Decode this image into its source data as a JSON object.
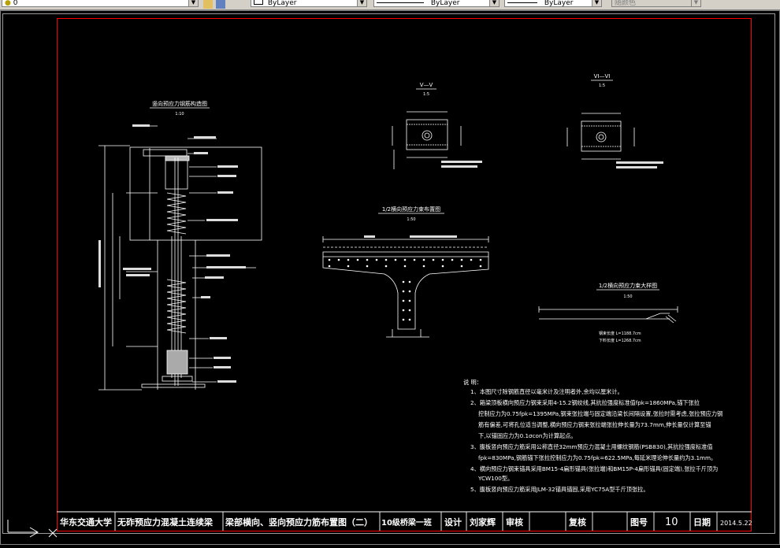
{
  "toolbar": {
    "layer_value": "0",
    "color_value": "ByLayer",
    "linetype_value": "ByLayer",
    "lineweight_value": "ByLayer",
    "plotstyle_value": "随颜色"
  },
  "drawing": {
    "left_title": "竖向预应力钢筋构造图",
    "left_scale": "1:10",
    "sec5_title": "V—V",
    "sec5_scale": "1:5",
    "sec6_title": "VI—VI",
    "sec6_scale": "1:5",
    "layout_title": "1/2横向预应力束布置图",
    "layout_scale": "1:50",
    "detail_title": "1/2横向预应力束大样图",
    "detail_scale": "1:50",
    "detail_len1": "钢束长度 L=1188.7cm",
    "detail_len2": "下料长度 L=1268.7cm"
  },
  "notes": {
    "heading": "说  明：",
    "items": [
      "1、本图尺寸除钢筋直径以毫米计及注明者外,余均以厘米计。",
      "2、箱梁顶板横向预应力钢束采用4-15.2钢绞线,其抗拉强度标准值fpk=1860MPa,锚下张拉",
      "控制应力为0.75fpk=1395MPa,钢束张拉端与固定端沿梁长间隔设置,张拉时需考虑,张拉预应力钢",
      "筋有偏差,可将孔位适当调整,横向预应力钢束张拉端张拉伸长量为73.7mm,伸长量仅计算至锚",
      "下,以锚固应力为0.1σcon为计算起点。",
      "3、腹板竖向预应力筋采用公称直径32mm预应力混凝土用螺纹钢筋(PSB830),其抗拉强度标准值",
      "fpk=830MPa,钢筋锚下张拉控制应力为0.75fpk=622.5MPa,每延米理论伸长量约为3.1mm。",
      "4、横向预应力钢束锚具采用BM15-4扁形锚具(张拉端)和BM15P-4扁形锚具(固定端),张拉千斤顶为",
      "YCW100型。",
      "5、腹板竖向预应力筋采用JLM-32锚具锚固,采用YC75A型千斤顶张拉。"
    ]
  },
  "title_block": {
    "school": "华东交通大学",
    "project": "无砟预应力混凝土连续梁",
    "drawing_name": "梁部横向、竖向预应力筋布置图（二）",
    "class": "10级桥梁一班",
    "design_label": "设计",
    "designer": "刘家辉",
    "review_label": "审核",
    "review_value": "",
    "recheck_label": "复核",
    "recheck_value": "",
    "fig_no_label": "图号",
    "fig_no": "10",
    "date_label": "日期",
    "date": "2014.5.22"
  },
  "colors": {
    "frame": "#ff0000",
    "line": "#ffffff",
    "canvas": "#000000",
    "hatch": "#cccccc"
  }
}
